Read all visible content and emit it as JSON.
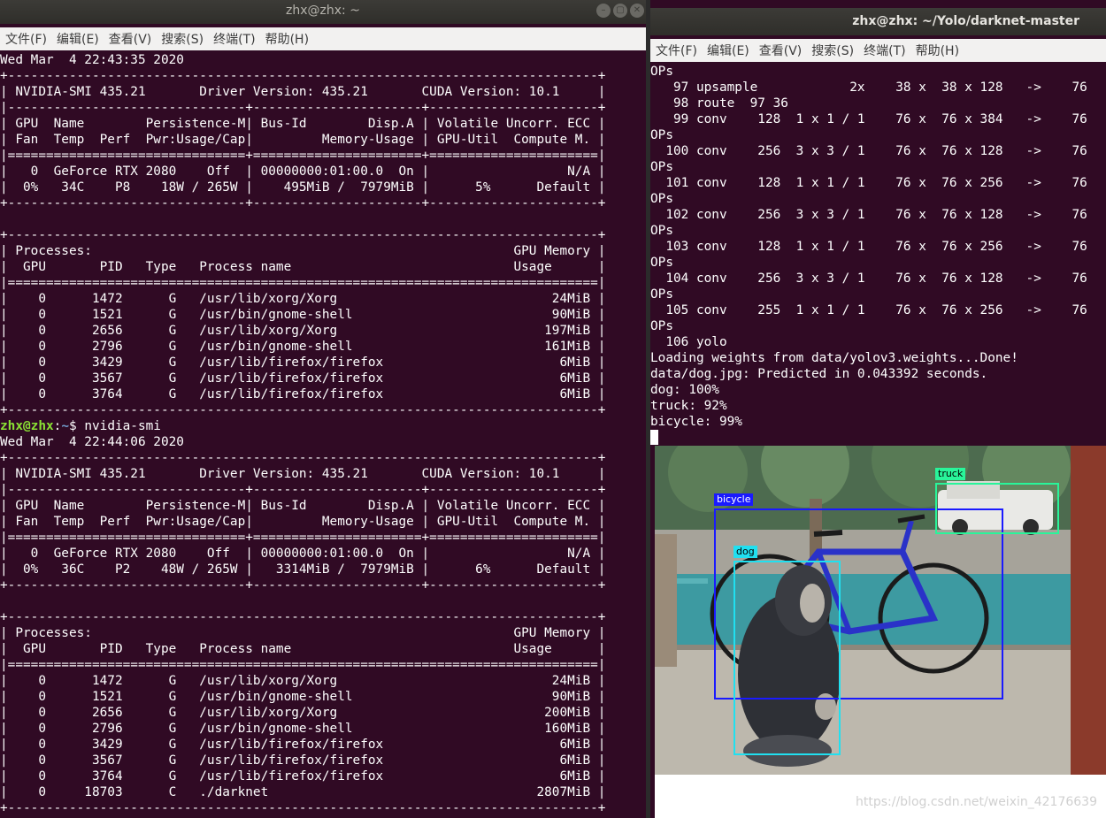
{
  "left_window": {
    "title": "zhx@zhx: ~",
    "menu": [
      "文件(F)",
      "编辑(E)",
      "查看(V)",
      "搜索(S)",
      "终端(T)",
      "帮助(H)"
    ],
    "lines": [
      "Wed Mar  4 22:43:35 2020",
      "+-----------------------------------------------------------------------------+",
      "| NVIDIA-SMI 435.21       Driver Version: 435.21       CUDA Version: 10.1     |",
      "|-------------------------------+----------------------+----------------------+",
      "| GPU  Name        Persistence-M| Bus-Id        Disp.A | Volatile Uncorr. ECC |",
      "| Fan  Temp  Perf  Pwr:Usage/Cap|         Memory-Usage | GPU-Util  Compute M. |",
      "|===============================+======================+======================|",
      "|   0  GeForce RTX 2080    Off  | 00000000:01:00.0  On |                  N/A |",
      "|  0%   34C    P8    18W / 265W |    495MiB /  7979MiB |      5%      Default |",
      "+-------------------------------+----------------------+----------------------+",
      "",
      "+-----------------------------------------------------------------------------+",
      "| Processes:                                                       GPU Memory |",
      "|  GPU       PID   Type   Process name                             Usage      |",
      "|=============================================================================|",
      "|    0      1472      G   /usr/lib/xorg/Xorg                            24MiB |",
      "|    0      1521      G   /usr/bin/gnome-shell                          90MiB |",
      "|    0      2656      G   /usr/lib/xorg/Xorg                           197MiB |",
      "|    0      2796      G   /usr/bin/gnome-shell                         161MiB |",
      "|    0      3429      G   /usr/lib/firefox/firefox                       6MiB |",
      "|    0      3567      G   /usr/lib/firefox/firefox                       6MiB |",
      "|    0      3764      G   /usr/lib/firefox/firefox                       6MiB |",
      "+-----------------------------------------------------------------------------+",
      "PROMPT",
      "Wed Mar  4 22:44:06 2020",
      "+-----------------------------------------------------------------------------+",
      "| NVIDIA-SMI 435.21       Driver Version: 435.21       CUDA Version: 10.1     |",
      "|-------------------------------+----------------------+----------------------+",
      "| GPU  Name        Persistence-M| Bus-Id        Disp.A | Volatile Uncorr. ECC |",
      "| Fan  Temp  Perf  Pwr:Usage/Cap|         Memory-Usage | GPU-Util  Compute M. |",
      "|===============================+======================+======================|",
      "|   0  GeForce RTX 2080    Off  | 00000000:01:00.0  On |                  N/A |",
      "|  0%   36C    P2    48W / 265W |   3314MiB /  7979MiB |      6%      Default |",
      "+-------------------------------+----------------------+----------------------+",
      "",
      "+-----------------------------------------------------------------------------+",
      "| Processes:                                                       GPU Memory |",
      "|  GPU       PID   Type   Process name                             Usage      |",
      "|=============================================================================|",
      "|    0      1472      G   /usr/lib/xorg/Xorg                            24MiB |",
      "|    0      1521      G   /usr/bin/gnome-shell                          90MiB |",
      "|    0      2656      G   /usr/lib/xorg/Xorg                           200MiB |",
      "|    0      2796      G   /usr/bin/gnome-shell                         160MiB |",
      "|    0      3429      G   /usr/lib/firefox/firefox                       6MiB |",
      "|    0      3567      G   /usr/lib/firefox/firefox                       6MiB |",
      "|    0      3764      G   /usr/lib/firefox/firefox                       6MiB |",
      "|    0     18703      C   ./darknet                                   2807MiB |",
      "+-----------------------------------------------------------------------------+"
    ],
    "prompt": {
      "user": "zhx@zhx",
      "sep": ":",
      "path": "~",
      "symbol": "$ ",
      "command": "nvidia-smi"
    }
  },
  "right_window": {
    "title": "zhx@zhx: ~/Yolo/darknet-master",
    "menu": [
      "文件(F)",
      "编辑(E)",
      "查看(V)",
      "搜索(S)",
      "终端(T)",
      "帮助(H)"
    ],
    "lines": [
      "OPs",
      "   97 upsample            2x    38 x  38 x 128   ->    76",
      "   98 route  97 36",
      "   99 conv    128  1 x 1 / 1    76 x  76 x 384   ->    76",
      "OPs",
      "  100 conv    256  3 x 3 / 1    76 x  76 x 128   ->    76",
      "OPs",
      "  101 conv    128  1 x 1 / 1    76 x  76 x 256   ->    76",
      "OPs",
      "  102 conv    256  3 x 3 / 1    76 x  76 x 128   ->    76",
      "OPs",
      "  103 conv    128  1 x 1 / 1    76 x  76 x 256   ->    76",
      "OPs",
      "  104 conv    256  3 x 3 / 1    76 x  76 x 128   ->    76",
      "OPs",
      "  105 conv    255  1 x 1 / 1    76 x  76 x 256   ->    76",
      "OPs",
      "  106 yolo",
      "Loading weights from data/yolov3.weights...Done!",
      "data/dog.jpg: Predicted in 0.043392 seconds.",
      "dog: 100%",
      "truck: 92%",
      "bicycle: 99%"
    ]
  },
  "detections": [
    {
      "label": "bicycle",
      "color": "#1a1aff"
    },
    {
      "label": "truck",
      "color": "#29f59a"
    },
    {
      "label": "dog",
      "color": "#20e0f0"
    }
  ],
  "watermark": "https://blog.csdn.net/weixin_42176639"
}
